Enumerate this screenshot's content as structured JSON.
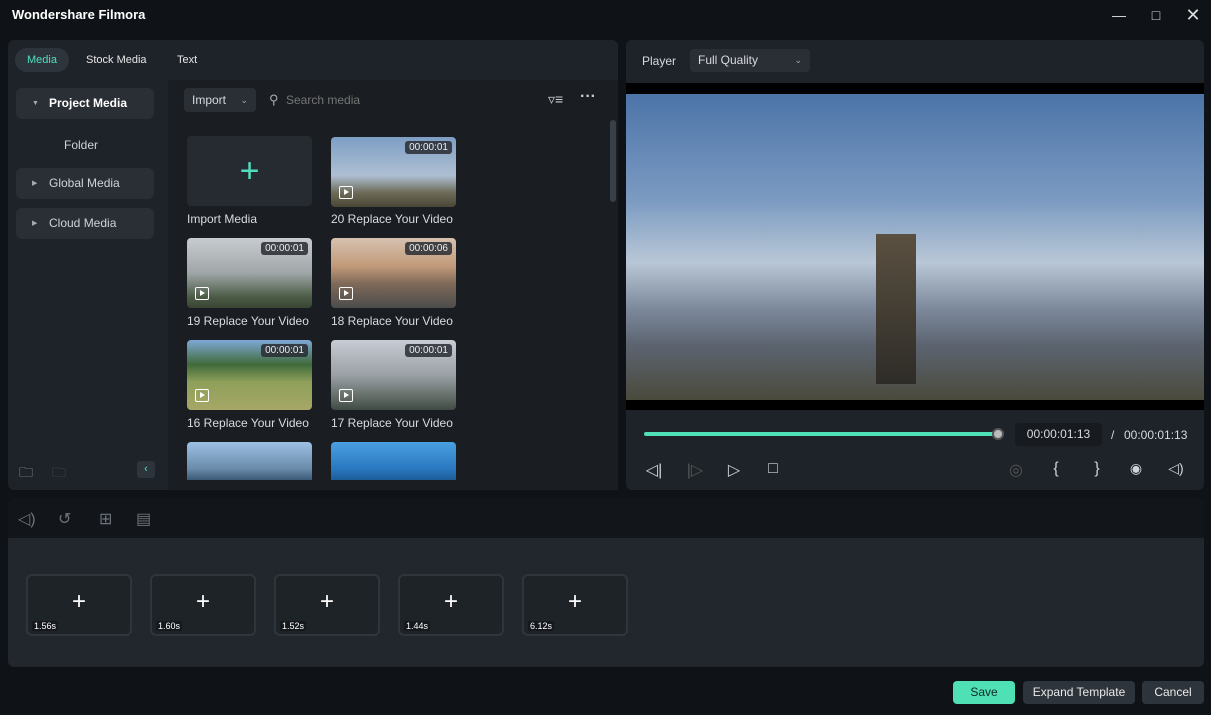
{
  "app": {
    "title": "Wondershare Filmora"
  },
  "window": {
    "minimize_icon": "minimize-icon",
    "maximize_icon": "maximize-icon",
    "close_icon": "close-icon"
  },
  "media_panel": {
    "tabs": [
      {
        "label": "Media",
        "active": true
      },
      {
        "label": "Stock Media"
      },
      {
        "label": "Text"
      }
    ],
    "sidebar": [
      {
        "label": "Project Media",
        "expanded": true
      },
      {
        "label": "Folder"
      },
      {
        "label": "Global Media"
      },
      {
        "label": "Cloud Media"
      }
    ],
    "import_label": "Import",
    "search_placeholder": "Search media",
    "items": [
      {
        "label": "Import Media"
      },
      {
        "label": "20 Replace Your Video",
        "duration": "00:00:01"
      },
      {
        "label": "19 Replace Your Video",
        "duration": "00:00:01"
      },
      {
        "label": "18 Replace Your Video",
        "duration": "00:00:06"
      },
      {
        "label": "16 Replace Your Video",
        "duration": "00:00:01"
      },
      {
        "label": "17 Replace Your Video",
        "duration": "00:00:01"
      }
    ]
  },
  "player": {
    "label": "Player",
    "quality": "Full Quality",
    "current_time": "00:00:01:13",
    "separator": "/",
    "total_time": "00:00:01:13",
    "progress": 1.0,
    "bracket_in": "{",
    "bracket_out": "}"
  },
  "timeline": {
    "slots": [
      "1.56s",
      "1.60s",
      "1.52s",
      "1.44s",
      "6.12s"
    ],
    "slot_add": "+"
  },
  "footer": {
    "save": "Save",
    "expand": "Expand Template",
    "cancel": "Cancel"
  },
  "colors": {
    "accent": "#4fe0b6"
  }
}
